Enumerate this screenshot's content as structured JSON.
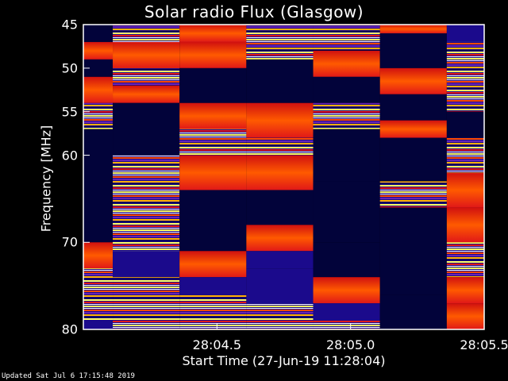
{
  "header": {
    "title": "Solar radio Flux (Glasgow)"
  },
  "footer": {
    "updated": "Updated Sat Jul  6 17:15:48 2019"
  },
  "chart_data": {
    "type": "heatmap",
    "title": "Solar radio Flux (Glasgow)",
    "xlabel": "Start Time (27-Jun-19 11:28:04)",
    "ylabel": "Frequency [MHz]",
    "xlim": [
      28.04,
      28.055
    ],
    "ylim": [
      45,
      80
    ],
    "y_inverted": true,
    "xticks": [
      "28:04.5",
      "28:05.0",
      "28:05.5"
    ],
    "yticks": [
      "45",
      "50",
      "55",
      "60",
      "70",
      "80"
    ],
    "palette": {
      "background": "#000000",
      "empty": "#02033a",
      "low": "#1b0a8c",
      "mid_low": "#6a22b5",
      "mid": "#e01818",
      "mid_high": "#ff4a00",
      "high": "#ffb000",
      "peak": "#ffff60",
      "max": "#ffffff"
    },
    "columns": [
      {
        "x0": 28.04,
        "x1": 28.0411,
        "blocks": [
          [
            45,
            47,
            "e"
          ],
          [
            47,
            49,
            "h"
          ],
          [
            49,
            51,
            "e"
          ],
          [
            51,
            54,
            "h"
          ],
          [
            54,
            57,
            "s"
          ],
          [
            57,
            70,
            "e"
          ],
          [
            70,
            73,
            "h"
          ],
          [
            73,
            79,
            "s"
          ],
          [
            79,
            80,
            "l"
          ]
        ]
      },
      {
        "x0": 28.0411,
        "x1": 28.0436,
        "blocks": [
          [
            45,
            47,
            "s"
          ],
          [
            47,
            50,
            "h"
          ],
          [
            50,
            52,
            "s"
          ],
          [
            52,
            54,
            "h"
          ],
          [
            54,
            60,
            "e"
          ],
          [
            60,
            65,
            "s"
          ],
          [
            65,
            71,
            "s"
          ],
          [
            71,
            74,
            "l"
          ],
          [
            74,
            80,
            "s"
          ]
        ]
      },
      {
        "x0": 28.0436,
        "x1": 28.0461,
        "blocks": [
          [
            45,
            47,
            "h"
          ],
          [
            47,
            50,
            "h"
          ],
          [
            50,
            54,
            "e"
          ],
          [
            54,
            57,
            "h"
          ],
          [
            57,
            60,
            "s"
          ],
          [
            60,
            64,
            "h"
          ],
          [
            64,
            71,
            "e"
          ],
          [
            71,
            74,
            "h"
          ],
          [
            74,
            76,
            "l"
          ],
          [
            76,
            80,
            "s"
          ]
        ]
      },
      {
        "x0": 28.0461,
        "x1": 28.0486,
        "blocks": [
          [
            45,
            49,
            "s"
          ],
          [
            49,
            54,
            "e"
          ],
          [
            54,
            58,
            "h"
          ],
          [
            58,
            60,
            "s"
          ],
          [
            60,
            64,
            "h"
          ],
          [
            64,
            68,
            "e"
          ],
          [
            68,
            71,
            "h"
          ],
          [
            71,
            73,
            "l"
          ],
          [
            73,
            77,
            "l"
          ],
          [
            77,
            80,
            "s"
          ]
        ]
      },
      {
        "x0": 28.0486,
        "x1": 28.0511,
        "blocks": [
          [
            45,
            48,
            "s"
          ],
          [
            48,
            51,
            "h"
          ],
          [
            51,
            54,
            "e"
          ],
          [
            54,
            57,
            "s"
          ],
          [
            57,
            63,
            "e"
          ],
          [
            63,
            70,
            "e"
          ],
          [
            70,
            74,
            "e"
          ],
          [
            74,
            77,
            "h"
          ],
          [
            77,
            79,
            "l"
          ],
          [
            79,
            80,
            "s"
          ]
        ]
      },
      {
        "x0": 28.0511,
        "x1": 28.0536,
        "blocks": [
          [
            45,
            46,
            "h"
          ],
          [
            46,
            50,
            "e"
          ],
          [
            50,
            53,
            "h"
          ],
          [
            53,
            56,
            "e"
          ],
          [
            56,
            58,
            "h"
          ],
          [
            58,
            63,
            "e"
          ],
          [
            63,
            66,
            "s"
          ],
          [
            66,
            76,
            "e"
          ],
          [
            76,
            80,
            "e"
          ]
        ]
      },
      {
        "x0": 28.0536,
        "x1": 28.055,
        "blocks": [
          [
            45,
            47,
            "l"
          ],
          [
            47,
            55,
            "s"
          ],
          [
            55,
            58,
            "e"
          ],
          [
            58,
            62,
            "s"
          ],
          [
            62,
            66,
            "h"
          ],
          [
            66,
            70,
            "h"
          ],
          [
            70,
            74,
            "s"
          ],
          [
            74,
            77,
            "h"
          ],
          [
            77,
            80,
            "h"
          ]
        ]
      }
    ]
  }
}
